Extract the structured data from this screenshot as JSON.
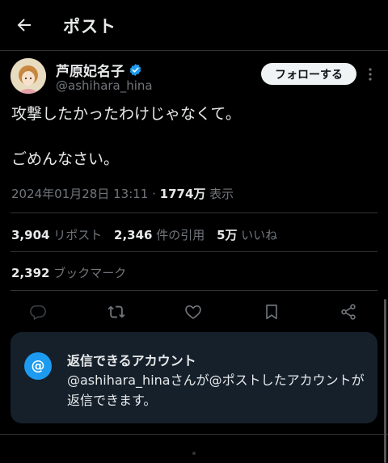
{
  "header": {
    "title": "ポスト"
  },
  "post": {
    "display_name": "芦原妃名子",
    "handle": "@ashihara_hina",
    "follow_label": "フォローする",
    "text_line1": "攻撃したかったわけじゃなくて。",
    "text_line2": "ごめんなさい。",
    "timestamp": "2024年01月28日 13:11 · ",
    "views_count": "1774万",
    "views_label": " 表示"
  },
  "stats": {
    "reposts_count": "3,904",
    "reposts_label": "リポスト",
    "quotes_count": "2,346",
    "quotes_label": "件の引用",
    "likes_count": "5万",
    "likes_label": "いいね",
    "bookmarks_count": "2,392",
    "bookmarks_label": "ブックマーク"
  },
  "reply_notice": {
    "icon_glyph": "@",
    "title": "返信できるアカウント",
    "description": "@ashihara_hinaさんが@ポストしたアカウントが返信できます。"
  },
  "colors": {
    "background": "#000000",
    "text": "#e7e9ea",
    "muted": "#71767b",
    "accent": "#1d9bf0",
    "notice_bg": "#15202b",
    "verified": "#1d9bf0"
  },
  "icons": [
    "back-arrow-icon",
    "verified-badge-icon",
    "more-icon",
    "reply-icon",
    "repost-icon",
    "like-icon",
    "bookmark-icon",
    "share-icon",
    "at-icon"
  ]
}
